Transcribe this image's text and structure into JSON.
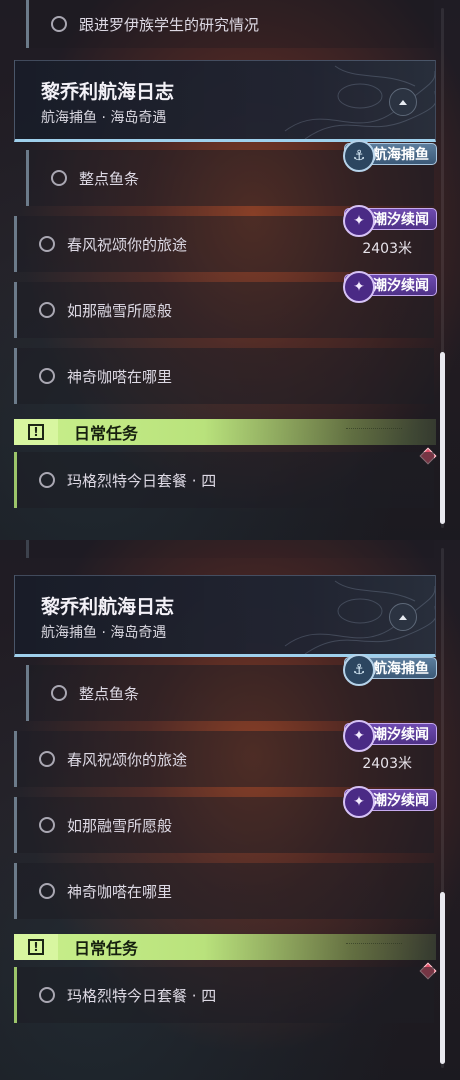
{
  "panels": [
    {
      "top_task": "跟进罗伊族学生的研究情况",
      "header": {
        "title": "黎乔利航海日志",
        "subtitle": "航海捕鱼 · 海岛奇遇"
      },
      "tags": {
        "fishing": "航海捕鱼",
        "tide1": "潮汐续闻",
        "tide2": "潮汐续闻"
      },
      "tasks": [
        "整点鱼条",
        "春风祝颂你的旅途",
        "如那融雪所愿般",
        "神奇咖嗒在哪里"
      ],
      "distance": "2403米",
      "daily": {
        "label": "日常任务",
        "task": "玛格烈特今日套餐 · 四"
      }
    },
    {
      "header": {
        "title": "黎乔利航海日志",
        "subtitle": "航海捕鱼 · 海岛奇遇"
      },
      "tags": {
        "fishing": "航海捕鱼",
        "tide1": "潮汐续闻",
        "tide2": "潮汐续闻"
      },
      "tasks": [
        "整点鱼条",
        "春风祝颂你的旅途",
        "如那融雪所愿般",
        "神奇咖嗒在哪里"
      ],
      "distance": "2403米",
      "daily": {
        "label": "日常任务",
        "task": "玛格烈特今日套餐 · 四"
      }
    }
  ]
}
